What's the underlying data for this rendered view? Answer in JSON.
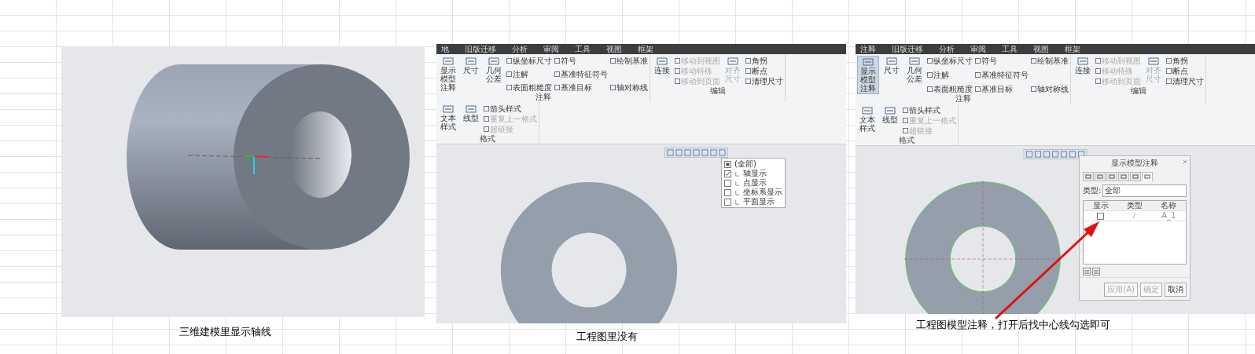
{
  "panels": [
    {
      "kind": "model3d",
      "caption": "三维建模里显示轴线"
    },
    {
      "kind": "drawing",
      "caption": "工程图里没有",
      "ribbon": {
        "tabs": [
          "地",
          "旧版迁移",
          "分析",
          "审阅",
          "工具",
          "视图",
          "框架"
        ],
        "groups": [
          {
            "label": "注释",
            "columns": [
              {
                "kind": "big",
                "label": "显示模型注释",
                "selected": false,
                "disabled": false
              },
              {
                "kind": "big",
                "label": "尺寸",
                "selected": false,
                "disabled": false
              },
              {
                "kind": "big",
                "label": "几何公差",
                "selected": false,
                "disabled": false
              },
              {
                "kind": "stack",
                "items": [
                  {
                    "label": "纵坐标尺寸",
                    "disabled": false
                  },
                  {
                    "label": "注解",
                    "disabled": false
                  },
                  {
                    "label": "表面粗糙度",
                    "disabled": false
                  }
                ]
              },
              {
                "kind": "stack",
                "items": [
                  {
                    "label": "符号",
                    "disabled": false
                  },
                  {
                    "label": "基准特征符号",
                    "disabled": false
                  },
                  {
                    "label": "基准目标",
                    "disabled": false
                  }
                ]
              },
              {
                "kind": "stack",
                "items": [
                  {
                    "label": "绘制基准",
                    "disabled": false
                  },
                  {
                    "label": "轴对称线",
                    "disabled": false
                  }
                ]
              }
            ]
          },
          {
            "label": "编辑",
            "columns": [
              {
                "kind": "big",
                "label": "连接",
                "selected": false,
                "disabled": false
              },
              {
                "kind": "stack",
                "items": [
                  {
                    "label": "移动到视图",
                    "disabled": true
                  },
                  {
                    "label": "移动特殊",
                    "disabled": true
                  },
                  {
                    "label": "移动到页面",
                    "disabled": true
                  }
                ]
              },
              {
                "kind": "big",
                "label": "对齐尺寸",
                "selected": false,
                "disabled": true
              },
              {
                "kind": "stack",
                "items": [
                  {
                    "label": "角拐",
                    "disabled": false
                  },
                  {
                    "label": "断点",
                    "disabled": false
                  },
                  {
                    "label": "清理尺寸",
                    "disabled": false
                  }
                ]
              }
            ]
          },
          {
            "label": "格式",
            "columns": [
              {
                "kind": "big",
                "label": "文本样式",
                "selected": false,
                "disabled": false
              },
              {
                "kind": "big",
                "label": "线型",
                "selected": false,
                "disabled": false
              },
              {
                "kind": "stack",
                "items": [
                  {
                    "label": "箭头样式",
                    "disabled": false
                  },
                  {
                    "label": "重复上一格式",
                    "disabled": true
                  },
                  {
                    "label": "超链接",
                    "disabled": true
                  }
                ]
              }
            ]
          }
        ]
      },
      "menu": [
        {
          "kind": "all",
          "label": "(全部)"
        },
        {
          "kind": "option",
          "label": "轴显示",
          "checked": true
        },
        {
          "kind": "option",
          "label": "点显示",
          "checked": false
        },
        {
          "kind": "option",
          "label": "坐标系显示",
          "checked": false
        },
        {
          "kind": "option",
          "label": "平面显示",
          "checked": false
        }
      ]
    },
    {
      "kind": "drawing_dialog",
      "caption": "工程图模型注释，打开后找中心线勾选即可",
      "ribbon": {
        "tabs": [
          "注释",
          "旧版迁移",
          "分析",
          "审阅",
          "工具",
          "视图",
          "框架"
        ],
        "groups": [
          {
            "label": "注释",
            "columns": [
              {
                "kind": "big",
                "label": "显示模型注释",
                "selected": true,
                "disabled": false
              },
              {
                "kind": "big",
                "label": "尺寸",
                "selected": false,
                "disabled": false
              },
              {
                "kind": "big",
                "label": "几何公差",
                "selected": false,
                "disabled": false
              },
              {
                "kind": "stack",
                "items": [
                  {
                    "label": "纵坐标尺寸",
                    "disabled": false
                  },
                  {
                    "label": "注解",
                    "disabled": false
                  },
                  {
                    "label": "表面粗糙度",
                    "disabled": false
                  }
                ]
              },
              {
                "kind": "stack",
                "items": [
                  {
                    "label": "符号",
                    "disabled": false
                  },
                  {
                    "label": "基准特征符号",
                    "disabled": false
                  },
                  {
                    "label": "基准目标",
                    "disabled": false
                  }
                ]
              },
              {
                "kind": "stack",
                "items": [
                  {
                    "label": "绘制基准",
                    "disabled": false
                  },
                  {
                    "label": "轴对称线",
                    "disabled": false
                  }
                ]
              }
            ]
          },
          {
            "label": "编辑",
            "columns": [
              {
                "kind": "big",
                "label": "连接",
                "selected": false,
                "disabled": false
              },
              {
                "kind": "stack",
                "items": [
                  {
                    "label": "移动到视图",
                    "disabled": true
                  },
                  {
                    "label": "移动特殊",
                    "disabled": true
                  },
                  {
                    "label": "移动到页面",
                    "disabled": true
                  }
                ]
              },
              {
                "kind": "big",
                "label": "对齐尺寸",
                "selected": false,
                "disabled": true
              },
              {
                "kind": "stack",
                "items": [
                  {
                    "label": "角拐",
                    "disabled": false
                  },
                  {
                    "label": "断点",
                    "disabled": false
                  },
                  {
                    "label": "清理尺寸",
                    "disabled": false
                  }
                ]
              }
            ]
          },
          {
            "label": "格式",
            "columns": [
              {
                "kind": "big",
                "label": "文本样式",
                "selected": false,
                "disabled": false
              },
              {
                "kind": "big",
                "label": "线型",
                "selected": false,
                "disabled": false
              },
              {
                "kind": "stack",
                "items": [
                  {
                    "label": "箭头样式",
                    "disabled": false
                  },
                  {
                    "label": "重复上一格式",
                    "disabled": true
                  },
                  {
                    "label": "超链接",
                    "disabled": true
                  }
                ]
              }
            ]
          }
        ]
      },
      "dialog": {
        "title": "显示模型注释",
        "tabs": [
          {
            "selected": false
          },
          {
            "selected": false
          },
          {
            "selected": false
          },
          {
            "selected": false
          },
          {
            "selected": false
          },
          {
            "selected": true
          }
        ],
        "type_label": "类型:",
        "type_value": "全部",
        "columns": [
          "显示",
          "类型",
          "名称"
        ],
        "rows": [
          {
            "checked": false,
            "name": "A_1"
          }
        ],
        "buttons": [
          {
            "label": "应用(A)",
            "disabled": true
          },
          {
            "label": "确定",
            "disabled": true
          },
          {
            "label": "取消",
            "disabled": false
          }
        ]
      }
    }
  ]
}
